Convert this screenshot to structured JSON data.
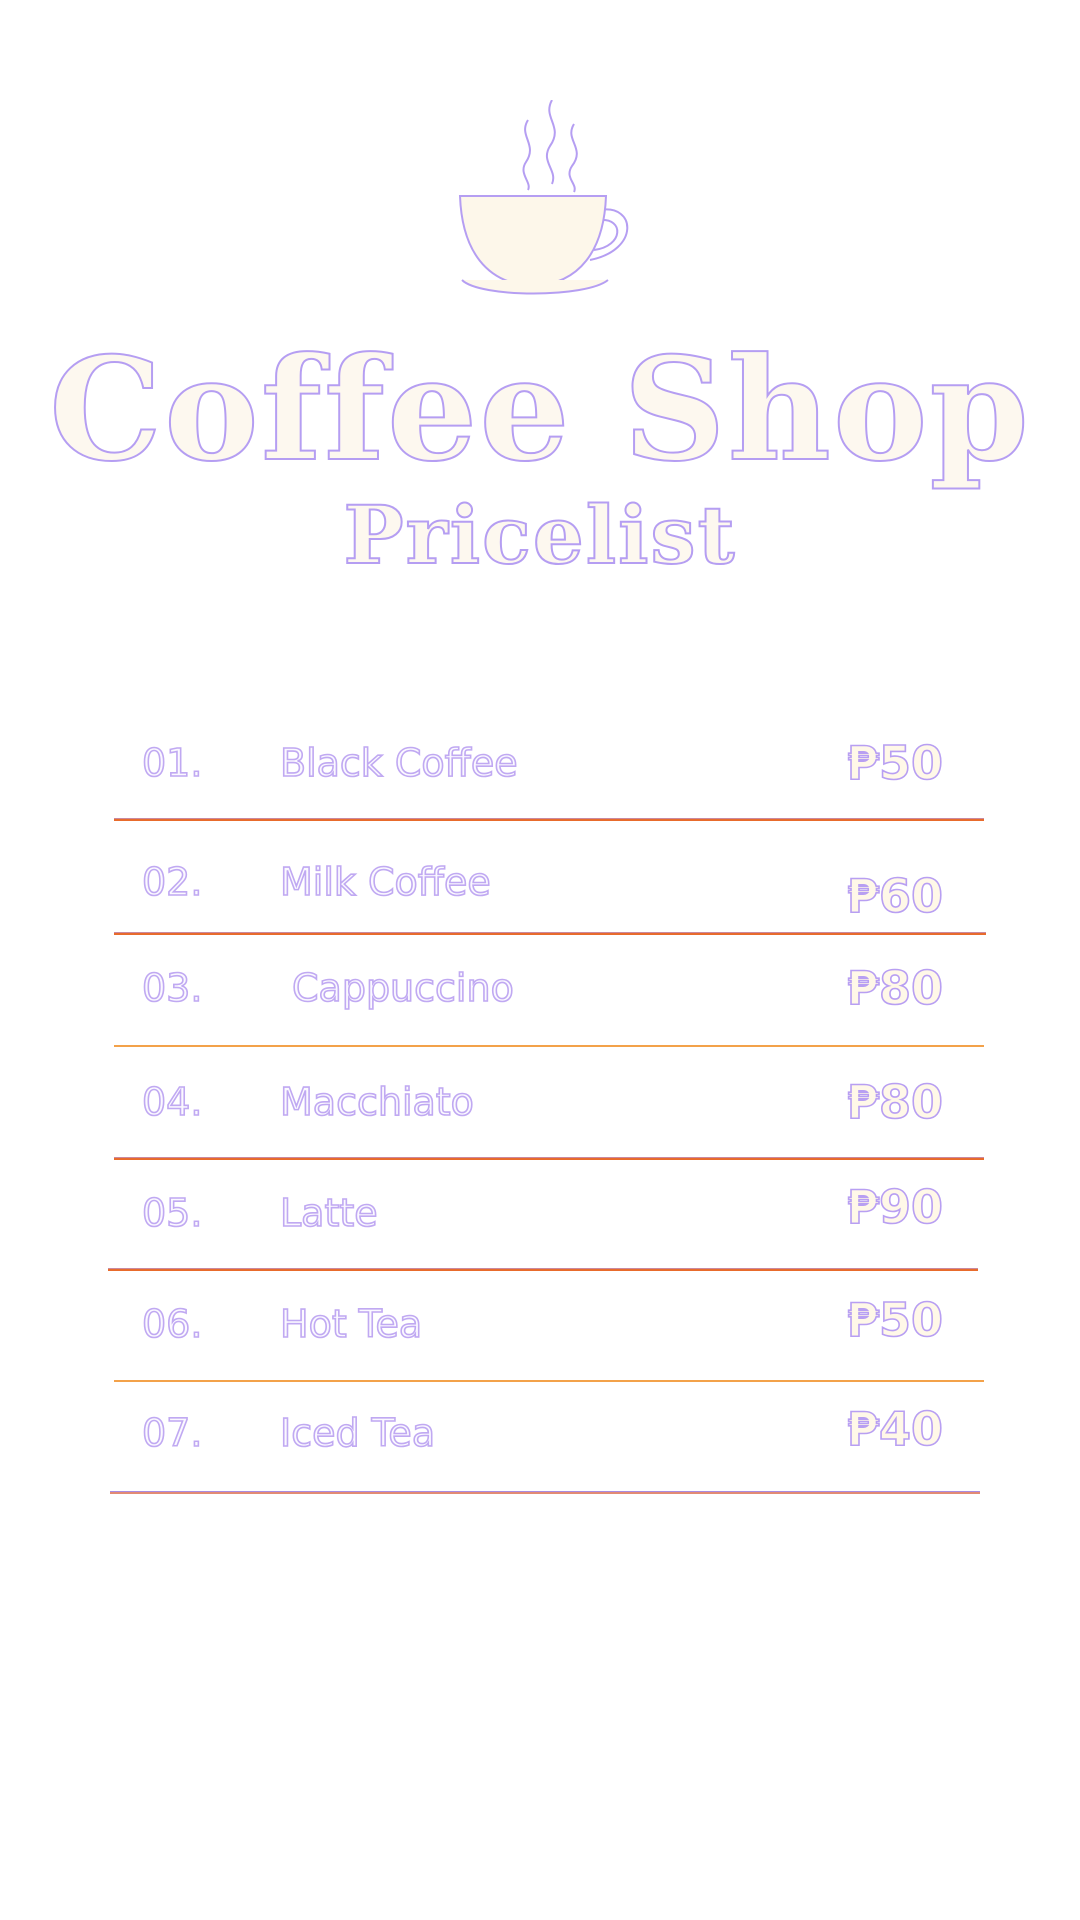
{
  "header": {
    "logo_icon": "coffee-cup-icon",
    "title": "Coffee Shop",
    "subtitle": "Pricelist"
  },
  "menu": {
    "items": [
      {
        "number": "01.",
        "name": "Black Coffee",
        "price": "₱50"
      },
      {
        "number": "02.",
        "name": "Milk Coffee",
        "price": "₱60"
      },
      {
        "number": "03.",
        "name": "Cappuccino",
        "price": "₱80"
      },
      {
        "number": "04.",
        "name": "Macchiato",
        "price": "₱80"
      },
      {
        "number": "05.",
        "name": "Latte",
        "price": "₱90"
      },
      {
        "number": "06.",
        "name": "Hot Tea",
        "price": "₱50"
      },
      {
        "number": "07.",
        "name": "Iced Tea",
        "price": "₱40"
      }
    ]
  },
  "colors": {
    "background": "#ffffff",
    "text_fill": "#fdf8ef",
    "text_outline": "#b59ef2",
    "divider_primary": "#e86b2c",
    "divider_secondary": "#f3a24a"
  }
}
